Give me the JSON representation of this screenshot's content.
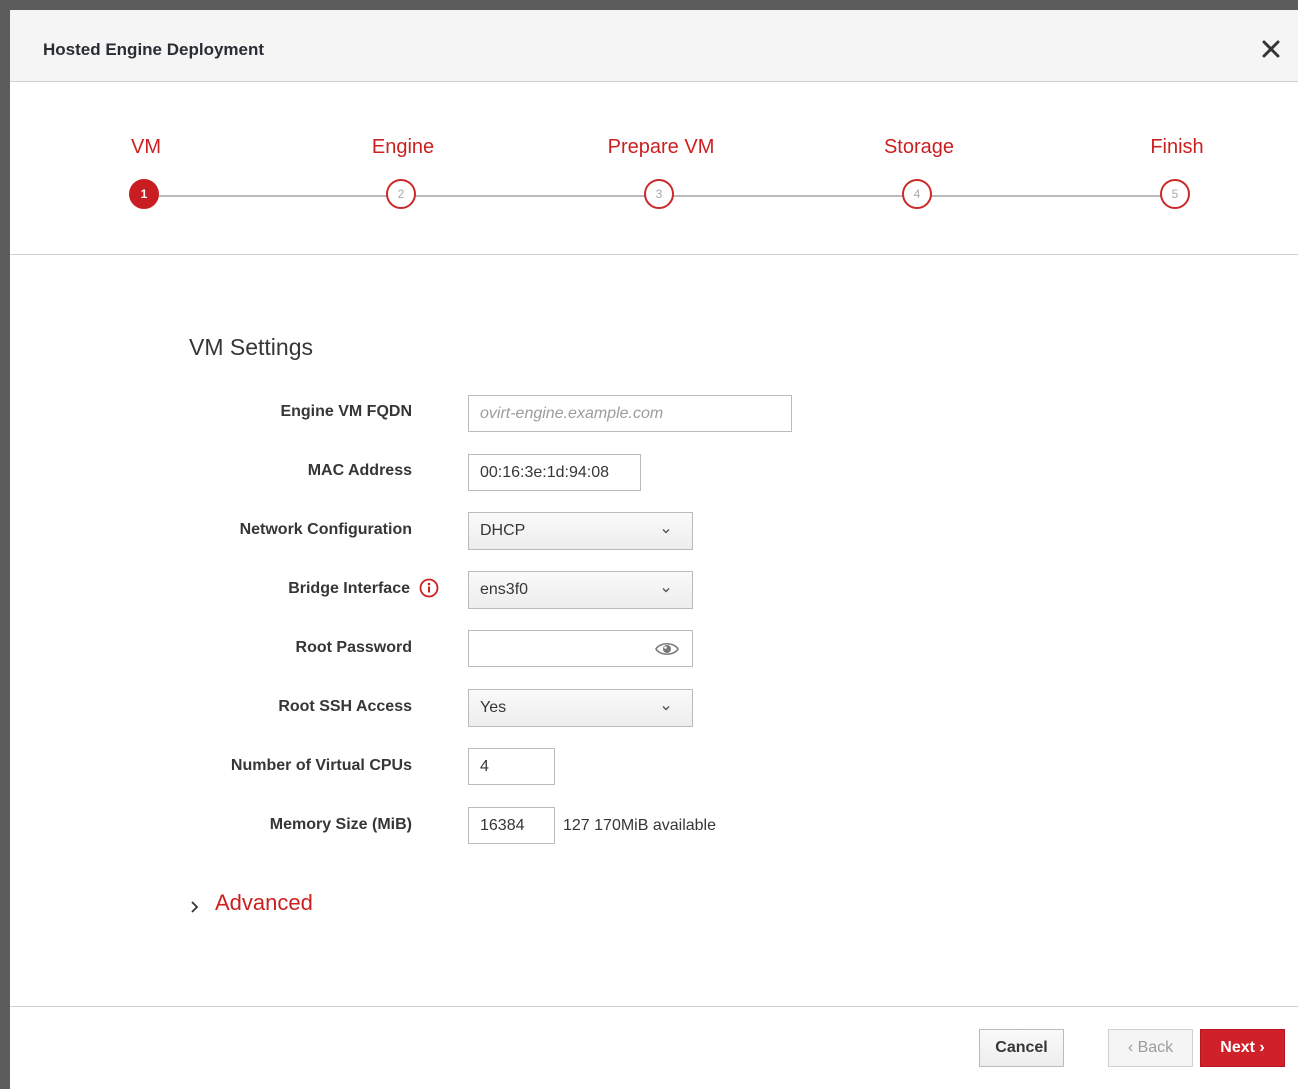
{
  "dialog": {
    "title": "Hosted Engine Deployment"
  },
  "wizard": {
    "steps": [
      {
        "label": "VM",
        "number": "1",
        "active": true
      },
      {
        "label": "Engine",
        "number": "2",
        "active": false
      },
      {
        "label": "Prepare VM",
        "number": "3",
        "active": false
      },
      {
        "label": "Storage",
        "number": "4",
        "active": false
      },
      {
        "label": "Finish",
        "number": "5",
        "active": false
      }
    ]
  },
  "form": {
    "section_title": "VM Settings",
    "fqdn": {
      "label": "Engine VM FQDN",
      "value": "",
      "placeholder": "ovirt-engine.example.com"
    },
    "mac": {
      "label": "MAC Address",
      "value": "00:16:3e:1d:94:08"
    },
    "network": {
      "label": "Network Configuration",
      "value": "DHCP"
    },
    "bridge": {
      "label": "Bridge Interface",
      "value": "ens3f0"
    },
    "root_password": {
      "label": "Root Password",
      "value": ""
    },
    "root_ssh": {
      "label": "Root SSH Access",
      "value": "Yes"
    },
    "vcpus": {
      "label": "Number of Virtual CPUs",
      "value": "4"
    },
    "memory": {
      "label": "Memory Size (MiB)",
      "value": "16384",
      "available": "127 170MiB available"
    },
    "advanced_label": "Advanced"
  },
  "footer": {
    "cancel_label": "Cancel",
    "back_label": "‹ Back",
    "next_label": "Next ›"
  },
  "colors": {
    "accent": "#cc1f1f",
    "primary_button": "#d0212a"
  },
  "icons": {
    "close": "close-icon",
    "info": "info-icon",
    "chevron": "chevron-down-icon",
    "eye": "eye-icon",
    "advanced": "chevron-right-icon"
  }
}
